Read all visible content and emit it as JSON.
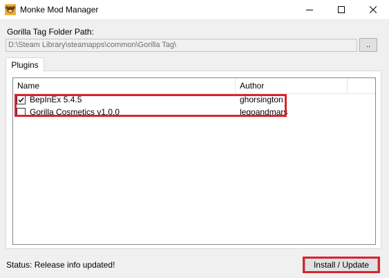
{
  "window": {
    "title": "Monke Mod Manager",
    "icons": {
      "app": "monkey-app-icon",
      "minimize": "minimize-icon",
      "maximize": "maximize-icon",
      "close": "close-icon"
    }
  },
  "folder": {
    "label": "Gorilla Tag Folder Path:",
    "path": "D:\\Steam Library\\steamapps\\common\\Gorilla Tag\\",
    "browse_label": ".."
  },
  "tabs": [
    {
      "label": "Plugins",
      "active": true
    }
  ],
  "plugins": {
    "columns": [
      "Name",
      "Author"
    ],
    "rows": [
      {
        "name": "BepInEx 5.4.5",
        "author": "ghorsington",
        "checked": true
      },
      {
        "name": "Gorilla Cosmetics v1.0.0",
        "author": "legoandmars",
        "checked": false
      }
    ]
  },
  "status": {
    "text": "Status: Release info updated!"
  },
  "install_button": {
    "label": "Install / Update"
  },
  "colors": {
    "highlight": "#d9232d",
    "window_bg": "#f0f0f0",
    "list_border": "#828790"
  }
}
